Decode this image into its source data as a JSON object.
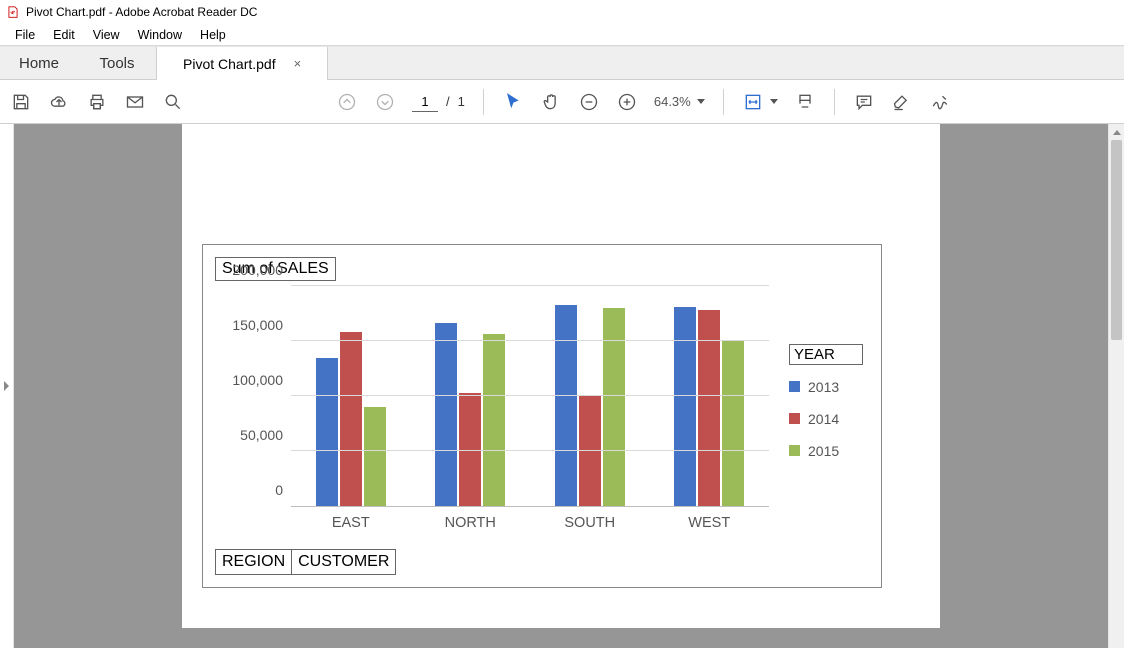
{
  "window_title": "Pivot Chart.pdf - Adobe Acrobat Reader DC",
  "menu": {
    "file": "File",
    "edit": "Edit",
    "view": "View",
    "window": "Window",
    "help": "Help"
  },
  "tabs": {
    "home": "Home",
    "tools": "Tools",
    "doc": "Pivot Chart.pdf"
  },
  "pagenav": {
    "current": "1",
    "sep": "/",
    "total": "1"
  },
  "zoom": {
    "pct": "64.3%"
  },
  "chart_data": {
    "type": "bar",
    "title": "Sum of SALES",
    "legend_title": "YEAR",
    "axis_fields": {
      "region": "REGION",
      "customer": "CUSTOMER"
    },
    "categories": [
      "EAST",
      "NORTH",
      "SOUTH",
      "WEST"
    ],
    "series": [
      {
        "name": "2013",
        "color": "#4472c4",
        "values": [
          135000,
          166000,
          183000,
          181000
        ]
      },
      {
        "name": "2014",
        "color": "#c0504d",
        "values": [
          158000,
          103000,
          100000,
          178000
        ]
      },
      {
        "name": "2015",
        "color": "#9bbb59",
        "values": [
          90000,
          156000,
          180000,
          150000
        ]
      }
    ],
    "ylim": [
      0,
      200000
    ],
    "yticks": [
      0,
      50000,
      100000,
      150000,
      200000
    ],
    "ytick_labels": [
      "0",
      "50,000",
      "100,000",
      "150,000",
      "200,000"
    ]
  }
}
